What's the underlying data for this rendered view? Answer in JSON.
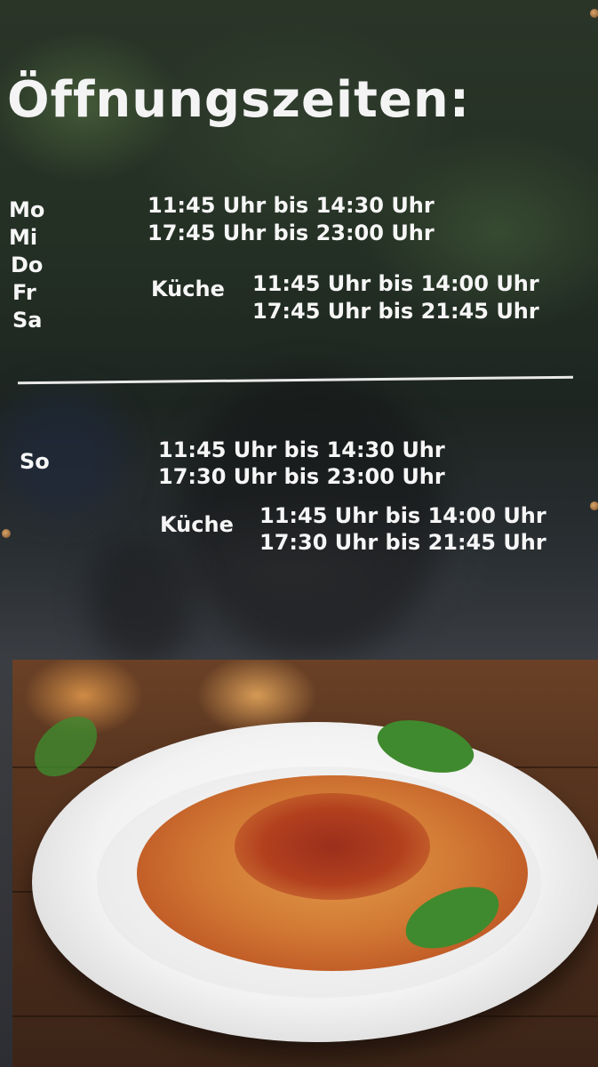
{
  "sign": {
    "title": "Öffnungszeiten:",
    "weekdays": {
      "days": [
        "Mo",
        "Mi",
        "Do",
        "Fr",
        "Sa"
      ],
      "hours": [
        "11:45 Uhr bis 14:30 Uhr",
        "17:45 Uhr bis 23:00 Uhr"
      ],
      "kitchen_label": "Küche",
      "kitchen_hours": [
        "11:45 Uhr bis 14:00 Uhr",
        "17:45 Uhr bis 21:45 Uhr"
      ]
    },
    "sunday": {
      "day": "So",
      "hours": [
        "11:45 Uhr bis 14:30 Uhr",
        "17:30 Uhr bis 23:00 Uhr"
      ],
      "kitchen_label": "Küche",
      "kitchen_hours": [
        "11:45 Uhr bis 14:00 Uhr",
        "17:30 Uhr bis 21:45 Uhr"
      ]
    }
  },
  "photo": {
    "subject": "spaghetti-bolognese-plate-icon"
  }
}
